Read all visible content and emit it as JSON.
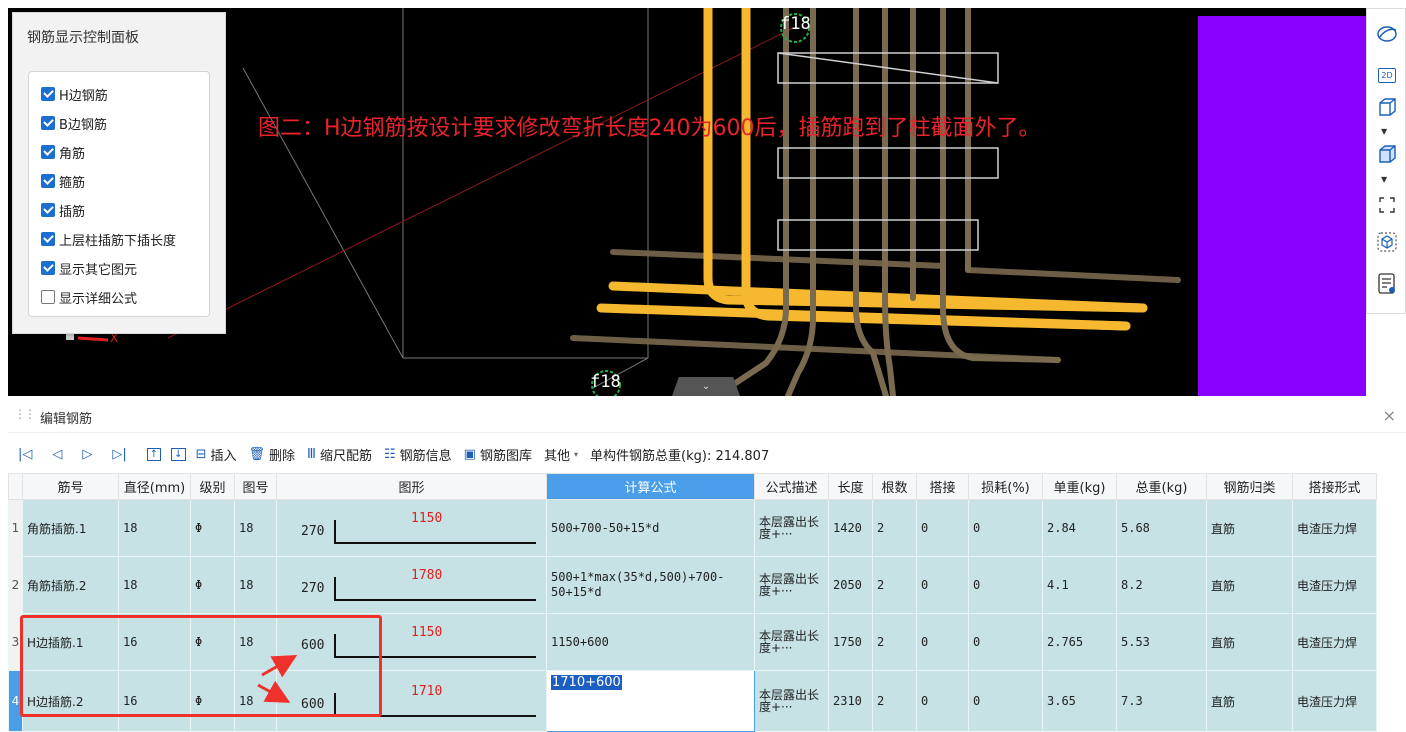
{
  "viewport": {
    "annotation": "图二：H边钢筋按设计要求修改弯折长度240为600后，插筋跑到了柱截面外了。",
    "label_top": "f18",
    "label_bottom": "f18",
    "axis_label": "X"
  },
  "control_panel": {
    "title": "钢筋显示控制面板",
    "options": [
      {
        "label": "H边钢筋",
        "checked": true
      },
      {
        "label": "B边钢筋",
        "checked": true
      },
      {
        "label": "角筋",
        "checked": true
      },
      {
        "label": "箍筋",
        "checked": true
      },
      {
        "label": "插筋",
        "checked": true
      },
      {
        "label": "上层柱插筋下插长度",
        "checked": true
      },
      {
        "label": "显示其它图元",
        "checked": true
      },
      {
        "label": "显示详细公式",
        "checked": false
      }
    ]
  },
  "right_toolbar": {
    "icons": [
      "orbit-icon",
      "2d-icon",
      "3d-box-icon",
      "3d-solid-icon",
      "fit-view-icon",
      "cube-select-icon",
      "list-view-icon"
    ],
    "label_2d": "2D"
  },
  "editor": {
    "title": "编辑钢筋",
    "toolbar": {
      "insert": "插入",
      "delete": "删除",
      "scale": "缩尺配筋",
      "info": "钢筋信息",
      "library": "钢筋图库",
      "other": "其他",
      "total_weight": "单构件钢筋总重(kg): 214.807"
    },
    "columns": [
      "筋号",
      "直径(mm)",
      "级别",
      "图号",
      "图形",
      "计算公式",
      "公式描述",
      "长度",
      "根数",
      "搭接",
      "损耗(%)",
      "单重(kg)",
      "总重(kg)",
      "钢筋归类",
      "搭接形式"
    ],
    "grade_symbol": "Φ",
    "rows": [
      {
        "num": "1",
        "name": "角筋插筋.1",
        "dia": "18",
        "grade": "Φ",
        "fig": "18",
        "shape_left": "270",
        "shape_len": "1150",
        "formula": "500+700-50+15*d",
        "desc": "本层露出长度+···",
        "length": "1420",
        "count": "2",
        "lap": "0",
        "loss": "0",
        "unit_w": "2.84",
        "total_w": "5.68",
        "category": "直筋",
        "lap_type": "电渣压力焊"
      },
      {
        "num": "2",
        "name": "角筋插筋.2",
        "dia": "18",
        "grade": "Φ",
        "fig": "18",
        "shape_left": "270",
        "shape_len": "1780",
        "formula": "500+1*max(35*d,500)+700-50+15*d",
        "desc": "本层露出长度+···",
        "length": "2050",
        "count": "2",
        "lap": "0",
        "loss": "0",
        "unit_w": "4.1",
        "total_w": "8.2",
        "category": "直筋",
        "lap_type": "电渣压力焊"
      },
      {
        "num": "3",
        "name": "H边插筋.1",
        "dia": "16",
        "grade": "Φ",
        "fig": "18",
        "shape_left": "600",
        "shape_len": "1150",
        "formula": "1150+600",
        "desc": "本层露出长度+···",
        "length": "1750",
        "count": "2",
        "lap": "0",
        "loss": "0",
        "unit_w": "2.765",
        "total_w": "5.53",
        "category": "直筋",
        "lap_type": "电渣压力焊"
      },
      {
        "num": "4",
        "name": "H边插筋.2",
        "dia": "16",
        "grade": "Φ",
        "fig": "18",
        "shape_left": "600",
        "shape_len": "1710",
        "formula": "1710+600",
        "desc": "本层露出长度+···",
        "length": "2310",
        "count": "2",
        "lap": "0",
        "loss": "0",
        "unit_w": "3.65",
        "total_w": "7.3",
        "category": "直筋",
        "lap_type": "电渣压力焊"
      }
    ]
  },
  "colors": {
    "accent": "#4a9de8",
    "row_bg": "#c6e2e4",
    "highlight_red": "#f0302a",
    "purple": "#8a00ff",
    "rebar_gold": "#f5b82e"
  }
}
